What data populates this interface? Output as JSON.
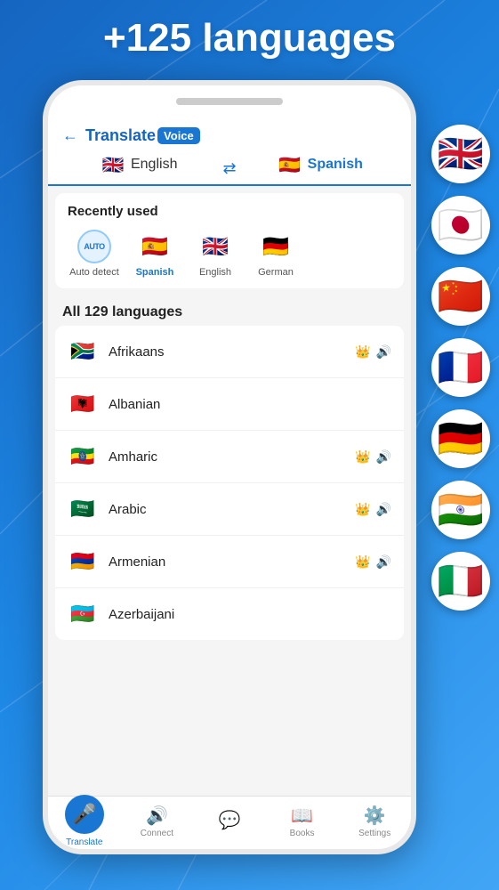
{
  "hero": {
    "title": "+125 languages"
  },
  "app": {
    "back_label": "←",
    "logo_translate": "Translate",
    "logo_voice": "Voice"
  },
  "lang_bar": {
    "source": {
      "name": "English",
      "flag": "🇬🇧"
    },
    "switch_icon": "⇄",
    "target": {
      "name": "Spanish",
      "flag": "🇪🇸"
    }
  },
  "recently_used": {
    "title": "Recently used",
    "items": [
      {
        "label": "Auto detect",
        "type": "auto",
        "flag": "AUTO",
        "highlight": false
      },
      {
        "label": "Spanish",
        "type": "flag",
        "flag": "🇪🇸",
        "highlight": true
      },
      {
        "label": "English",
        "type": "flag",
        "flag": "🇬🇧",
        "highlight": false
      },
      {
        "label": "German",
        "type": "flag",
        "flag": "🇩🇪",
        "highlight": false
      }
    ]
  },
  "all_languages": {
    "title": "All 129 languages",
    "items": [
      {
        "name": "Afrikaans",
        "flag": "🇿🇦",
        "crown": true,
        "voice": true
      },
      {
        "name": "Albanian",
        "flag": "🇦🇱",
        "crown": false,
        "voice": false
      },
      {
        "name": "Amharic",
        "flag": "🇪🇹",
        "crown": true,
        "voice": true
      },
      {
        "name": "Arabic",
        "flag": "🇸🇦",
        "crown": true,
        "voice": true
      },
      {
        "name": "Armenian",
        "flag": "🇦🇲",
        "crown": true,
        "voice": true
      },
      {
        "name": "Azerbaijani",
        "flag": "🇦🇿",
        "crown": false,
        "voice": false
      }
    ]
  },
  "bottom_nav": {
    "items": [
      {
        "label": "Translate",
        "icon": "🎤",
        "active": true
      },
      {
        "label": "Connect",
        "icon": "🔊",
        "active": false
      },
      {
        "label": "",
        "icon": "💬",
        "active": false,
        "center": true
      },
      {
        "label": "Books",
        "icon": "📖",
        "active": false
      },
      {
        "label": "Settings",
        "icon": "⚙",
        "active": false
      }
    ]
  },
  "floating_flags": [
    {
      "flag": "🇬🇧",
      "label": "uk-flag"
    },
    {
      "flag": "🇯🇵",
      "label": "japan-flag"
    },
    {
      "flag": "🇨🇳",
      "label": "china-flag"
    },
    {
      "flag": "🇫🇷",
      "label": "france-flag"
    },
    {
      "flag": "🇩🇪",
      "label": "germany-flag"
    },
    {
      "flag": "🇮🇳",
      "label": "india-flag"
    },
    {
      "flag": "🇮🇹",
      "label": "italy-flag"
    }
  ],
  "icons": {
    "crown": "👑",
    "voice": "🔊",
    "translate": "🎤",
    "connect": "🔊",
    "bubble": "💬",
    "books": "📖",
    "settings": "⚙️",
    "back": "←",
    "switch": "⇄"
  }
}
